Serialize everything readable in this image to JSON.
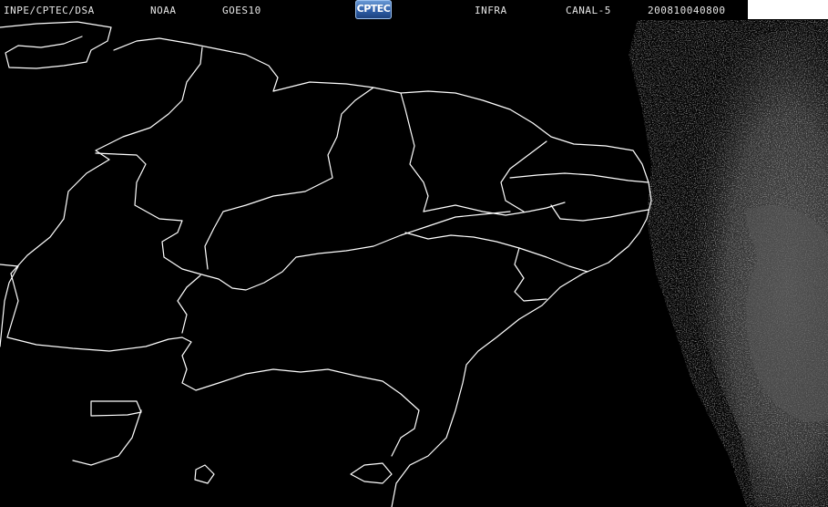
{
  "header": {
    "agency": "INPE/CPTEC/DSA",
    "source": "NOAA",
    "satellite": "GOES10",
    "logo_text": "CPTEC",
    "band": "INFRA",
    "channel": "CANAL-5",
    "datetime": "200810040800"
  },
  "colors": {
    "background": "#000000",
    "boundaries": "#ffffff",
    "cloud": "#4a4a4a",
    "logo_blue": "#2e5ea8"
  }
}
